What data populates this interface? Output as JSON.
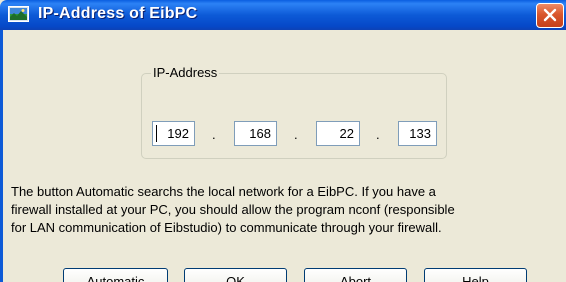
{
  "window": {
    "title": "IP-Address of EibPC"
  },
  "ip_group": {
    "legend": "IP-Address",
    "octets": [
      "192",
      "168",
      "22",
      "133"
    ],
    "separator": "."
  },
  "info": {
    "lines": [
      "The button Automatic searchs the local network for a EibPC. If you have a",
      "firewall installed at your PC, you should allow the program nconf (responsible",
      "for LAN communication of Eibstudio) to communicate through your firewall."
    ]
  },
  "buttons": {
    "automatic": "Automatic",
    "ok": "OK",
    "abort": "Abort",
    "help": "Help"
  },
  "icons": {
    "app": "monitor-icon",
    "close": "close-icon"
  },
  "colors": {
    "titlebar": "#0d5ad7",
    "close_button": "#d9572d",
    "dialog_background": "#ece9d8",
    "button_border": "#003c74"
  }
}
